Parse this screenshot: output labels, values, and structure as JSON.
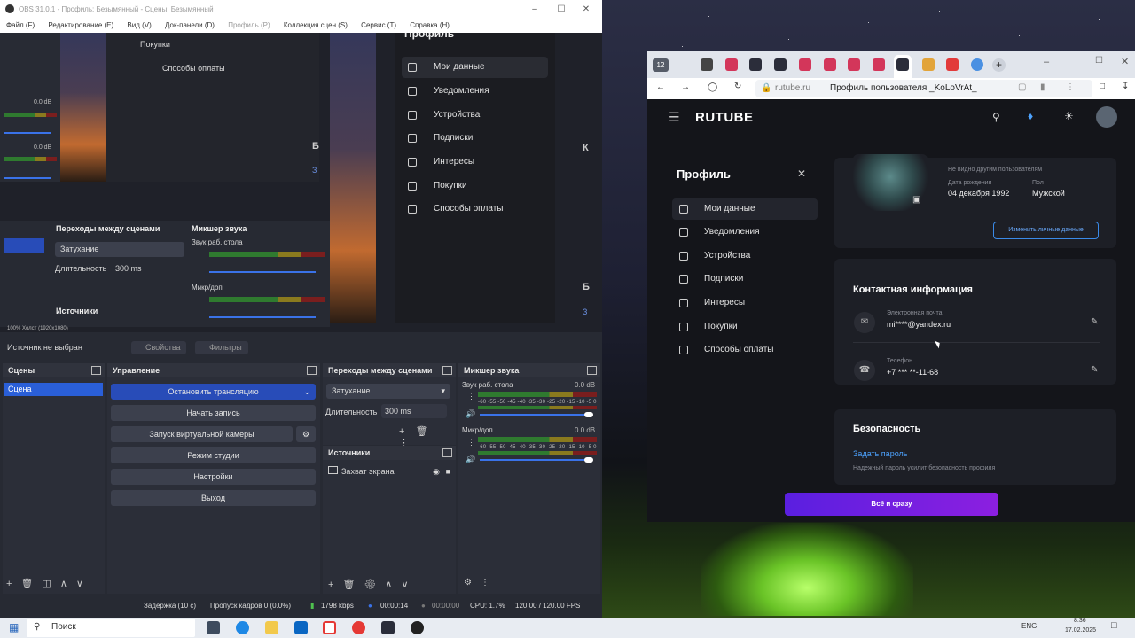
{
  "obs": {
    "title": "OBS 31.0.1 - Профиль: Безымянный - Сцены: Безымянный",
    "menu": [
      "Файл (F)",
      "Редактирование (E)",
      "Вид (V)",
      "Док-панели (D)",
      "Профиль (P)",
      "Коллекция сцен (S)",
      "Сервис (T)",
      "Справка (H)"
    ],
    "no_source": "Источник не выбран",
    "properties": "Свойства",
    "filters": "Фильтры",
    "canvas": "100%   Холст (1920x1080)",
    "scenes": {
      "title": "Сцены",
      "items": [
        "Сцена"
      ]
    },
    "controls": {
      "title": "Управление",
      "stop_stream": "Остановить трансляцию",
      "start_record": "Начать запись",
      "virtual_cam": "Запуск виртуальной камеры",
      "studio_mode": "Режим студии",
      "settings": "Настройки",
      "exit": "Выход"
    },
    "transitions": {
      "title": "Переходы между сценами",
      "selected": "Затухание",
      "duration_label": "Длительность",
      "duration": "300 ms"
    },
    "sources": {
      "title": "Источники",
      "items": [
        "Захват экрана"
      ]
    },
    "mixer": {
      "title": "Микшер звука",
      "channels": [
        {
          "name": "Звук раб. стола",
          "db": "0.0 dB"
        },
        {
          "name": "Микр/доп",
          "db": "0.0 dB"
        }
      ],
      "scale": "-60 -55 -50 -45 -40 -35 -30 -25 -20 -15 -10 -5 0"
    },
    "ghost": {
      "purchases": "Покупки",
      "payment": "Способы оплаты",
      "mini_db": "0.0 dB",
      "mini_scale": "-45-40-35-30-25-20-15-10-5 0",
      "mini_transitions": "Переходы между сценами",
      "mini_mixer": "Микшер звука",
      "mini_fade": "Затухание",
      "mini_duration": "Длительность",
      "mini_ms": "300 ms",
      "mini_ch1": "Звук раб. стола",
      "mini_ch2": "Микр/доп",
      "mini_sources": "Источники",
      "mini_canvas": "100%   Холст (1920x1080)"
    },
    "status": {
      "delay": "Задержка (10 с)",
      "dropped": "Пропуск кадров 0 (0.0%)",
      "bitrate": "1798 kbps",
      "stream_time": "00:00:14",
      "record_time": "00:00:00",
      "cpu": "CPU: 1.7%",
      "fps": "120.00 / 120.00 FPS"
    }
  },
  "overlay_menu": {
    "title": "Профиль",
    "items": [
      "Мои данные",
      "Уведомления",
      "Устройства",
      "Подписки",
      "Интересы",
      "Покупки",
      "Способы оплаты"
    ]
  },
  "browser": {
    "tab_count": "12",
    "url_domain": "rutube.ru",
    "url_title": "Профиль пользователя _KoLoVrAt_",
    "logo": "RUTUBE",
    "profile_title": "Профиль",
    "side_items": [
      "Мои данные",
      "Уведомления",
      "Устройства",
      "Подписки",
      "Интересы",
      "Покупки",
      "Способы оплаты"
    ],
    "hidden_note": "Не видно другим пользователям",
    "birth_label": "Дата рождения",
    "birth_value": "04 декабря 1992",
    "gender_label": "Пол",
    "gender_value": "Мужской",
    "edit_btn": "Изменить личные данные",
    "contact_title": "Контактная информация",
    "email_label": "Электронная почта",
    "email_value": "mi****@yandex.ru",
    "phone_label": "Телефон",
    "phone_value": "+7 *** **-11-68",
    "security_title": "Безопасность",
    "set_password": "Задать пароль",
    "password_hint": "Надежный пароль усилит безопасность профиля",
    "promo_btn": "Всё и сразу"
  },
  "ghost_letters": {
    "b1": "Б",
    "b2": "З",
    "k": "К",
    "b3": "Б",
    "b4": "З"
  },
  "taskbar": {
    "search": "Поиск",
    "lang": "ENG",
    "time": "8:36",
    "date": "17.02.2025"
  }
}
